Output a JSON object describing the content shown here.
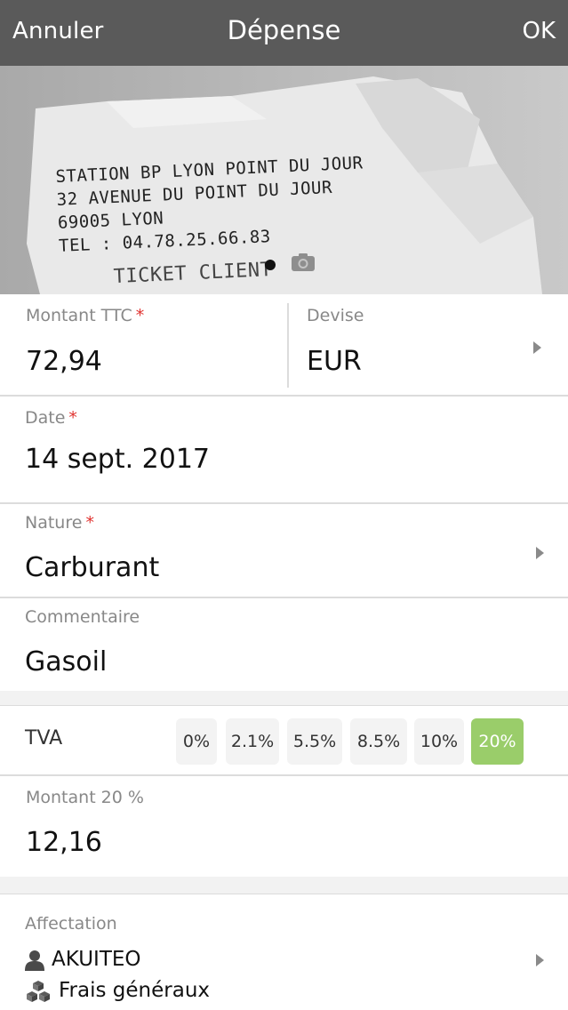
{
  "nav": {
    "left": "Annuler",
    "title": "Dépense",
    "right": "OK"
  },
  "receipt": {
    "lines": [
      "STATION BP LYON POINT DU JOUR",
      "32 AVENUE DU POINT DU JOUR",
      "69005 LYON",
      "TEL : 04.78.25.66.83"
    ],
    "partial_line": "TICKET CLIENT",
    "icons": [
      "pager-dot",
      "camera-icon"
    ]
  },
  "fields": {
    "montant": {
      "label": "Montant TTC",
      "required": "*",
      "value": "72,94"
    },
    "devise": {
      "label": "Devise",
      "value": "EUR"
    },
    "date": {
      "label": "Date",
      "required": "*",
      "value": "14 sept. 2017"
    },
    "nature": {
      "label": "Nature",
      "required": "*",
      "value": "Carburant"
    },
    "commentaire": {
      "label": "Commentaire",
      "value": "Gasoil"
    }
  },
  "tva": {
    "label": "TVA",
    "options": [
      "0%",
      "2.1%",
      "5.5%",
      "8.5%",
      "10%",
      "20%"
    ],
    "selected": "20%",
    "accent": "#9acd6a"
  },
  "montant20": {
    "label": "Montant 20 %",
    "value": "12,16"
  },
  "affectation": {
    "label": "Affectation",
    "person": "AKUITEO",
    "category": "Frais généraux",
    "icons": [
      "person-icon",
      "boxes-icon"
    ]
  },
  "colors": {
    "navbar": "#5a5a5a",
    "required": "#e0322f",
    "label": "#888888"
  }
}
